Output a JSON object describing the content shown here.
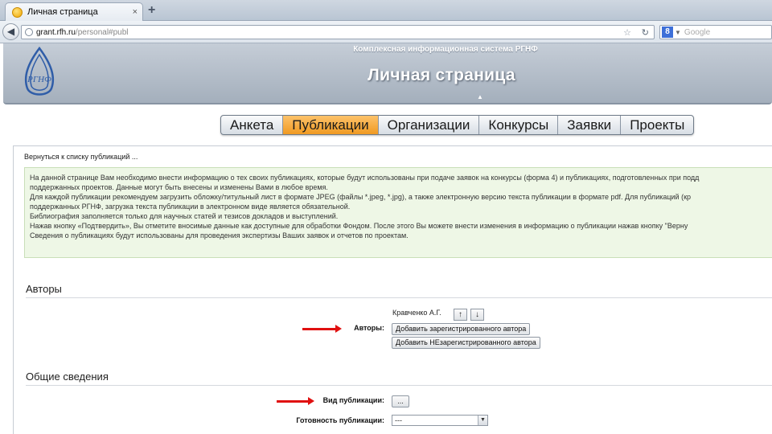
{
  "browser": {
    "tab_title": "Личная страница",
    "new_tab_symbol": "+",
    "tab_close_symbol": "×",
    "url_host": "grant.rfh.ru",
    "url_path": "/personal#publ",
    "search_placeholder": "Google",
    "search_engine_letter": "8"
  },
  "header": {
    "system_title": "Комплексная информационная система РГНФ",
    "page_title": "Личная страница",
    "collapse_symbol": "▲",
    "logo_text": "РГНФ"
  },
  "menu": {
    "items": [
      {
        "label": "Анкета",
        "active": false
      },
      {
        "label": "Публикации",
        "active": true
      },
      {
        "label": "Организации",
        "active": false
      },
      {
        "label": "Конкурсы",
        "active": false
      },
      {
        "label": "Заявки",
        "active": false
      },
      {
        "label": "Проекты",
        "active": false
      }
    ],
    "active_color": "#f5a832"
  },
  "content": {
    "back_link": "Вернуться к списку публикаций ...",
    "info_lines": [
      "На данной странице Вам необходимо внести информацию о тех своих публикациях, которые будут использованы при подаче заявок на конкурсы (форма 4) и публикациях, подготовленных при подд",
      "поддержанных проектов. Данные могут быть внесены и изменены Вами в любое время.",
      "Для каждой публикации рекомендуем загрузить обложку/титульный лист в формате JPEG (файлы *.jpeg, *.jpg), а также электронную версию текста публикации в формате pdf. Для публикаций (кр",
      "поддержанных РГНФ, загрузка текста публикации в электронном виде является обязательной.",
      "Библиография заполняется только для научных статей и тезисов докладов и выступлений.",
      "Нажав кнопку «Подтвердить», Вы отметите вносимые данные как доступные для обработки Фондом. После этого Вы можете внести изменения в информацию о публикации нажав кнопку \"Верну",
      "Сведения о публикациях будут использованы для проведения экспертизы Ваших заявок и отчетов по проектам."
    ],
    "info_bg": "#eef7e6"
  },
  "authors_section": {
    "title": "Авторы",
    "field_label": "Авторы:",
    "author_name": "Кравченко А.Г.",
    "up_symbol": "↑",
    "down_symbol": "↓",
    "add_registered_button": "Добавить зарегистрированного автора",
    "add_unregistered_button": "Добавить НЕзарегистрированного автора"
  },
  "general_section": {
    "title": "Общие сведения",
    "pub_type_label": "Вид публикации:",
    "pub_type_button": "...",
    "readiness_label": "Готовность публикации:",
    "readiness_value": "---"
  },
  "annotation_color": "#e01010"
}
